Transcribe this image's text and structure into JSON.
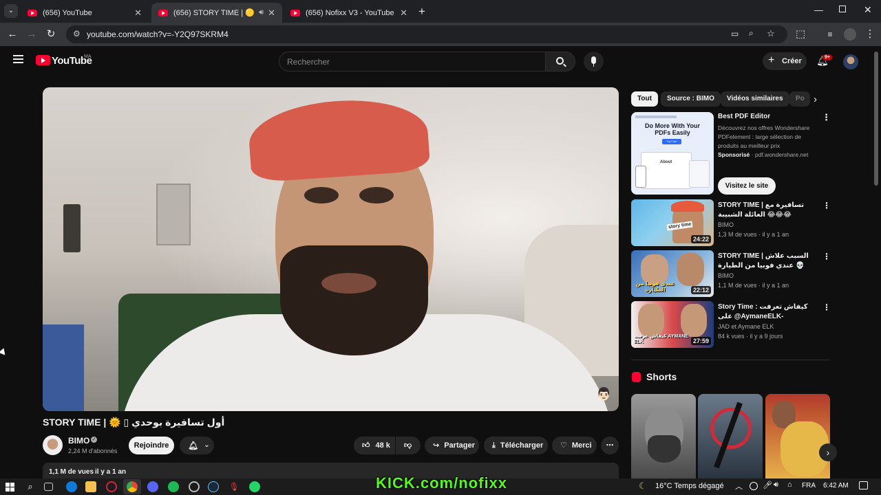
{
  "browser": {
    "tabs": [
      {
        "title": "(656) YouTube",
        "active": false
      },
      {
        "title": "(656) STORY TIME | 🟡 ▯ي...",
        "active": true
      },
      {
        "title": "(656) Nofixx V3 - YouTube",
        "active": false
      }
    ],
    "url": "youtube.com/watch?v=-Y2Q97SKRM4"
  },
  "youtube": {
    "logo_text": "YouTube",
    "region": "MA",
    "search_placeholder": "Rechercher",
    "create_label": "Créer",
    "notif_badge": "9+"
  },
  "video": {
    "title_left": "STORY TIME | 🌞 ▯",
    "title_arabic": "أول تسافيرة بوحدي",
    "channel": "BIMO",
    "subscribers": "2,24 M d'abonnés",
    "join_label": "Rejoindre",
    "likes": "48 k",
    "share_label": "Partager",
    "download_label": "Télécharger",
    "thanks_label": "Merci",
    "views": "1,1 M de vues",
    "age": "il y a 1 an"
  },
  "sidebar": {
    "chips": [
      "Tout",
      "Source : BIMO",
      "Vidéos similaires",
      "Po"
    ],
    "ad": {
      "title": "Best PDF Editor",
      "desc": "Découvrez nos offres Wondershare PDFelement : large sélection de produits au meilleur prix",
      "sponsored": "Sponsorisé",
      "domain": "pdf.wondershare.net",
      "cta": "Visitez le site",
      "thumb_headline": "Do More With Your PDFs Easily",
      "thumb_btn": "Try Free",
      "thumb_label": "About"
    },
    "recos": [
      {
        "title": "STORY TIME | تسافيرة مع العائلة الشبيبة 😂😂😂",
        "channel": "BIMO",
        "meta": "1,3 M de vues · il y a 1 an",
        "duration": "24:22",
        "thumb_text": "story time"
      },
      {
        "title": "STORY TIME | السبب علاش عندي فوبيا من الطيارة 💀",
        "channel": "BIMO",
        "meta": "1,1 M de vues · il y a 1 an",
        "duration": "22:12",
        "thumb_text": "عندي فوبيا من الطيارة"
      },
      {
        "title": "Story Time : كيفاش تعرفت على @AymaneELK-",
        "channel": "JAD et Aymane ELK",
        "meta": "84 k vues · il y a 9 jours",
        "duration": "27:59",
        "thumb_text": "كيفاش عرفت AYMANE ELK"
      }
    ],
    "shorts_label": "Shorts"
  },
  "overlay_text": "KICK.com/nofixx",
  "taskbar": {
    "weather": "16°C  Temps dégagé",
    "lang": "FRA",
    "time": "6:42 AM"
  },
  "colors": {
    "yt_red": "#ff0033",
    "bg": "#0f0f0f",
    "kick_green": "#53fc18"
  }
}
